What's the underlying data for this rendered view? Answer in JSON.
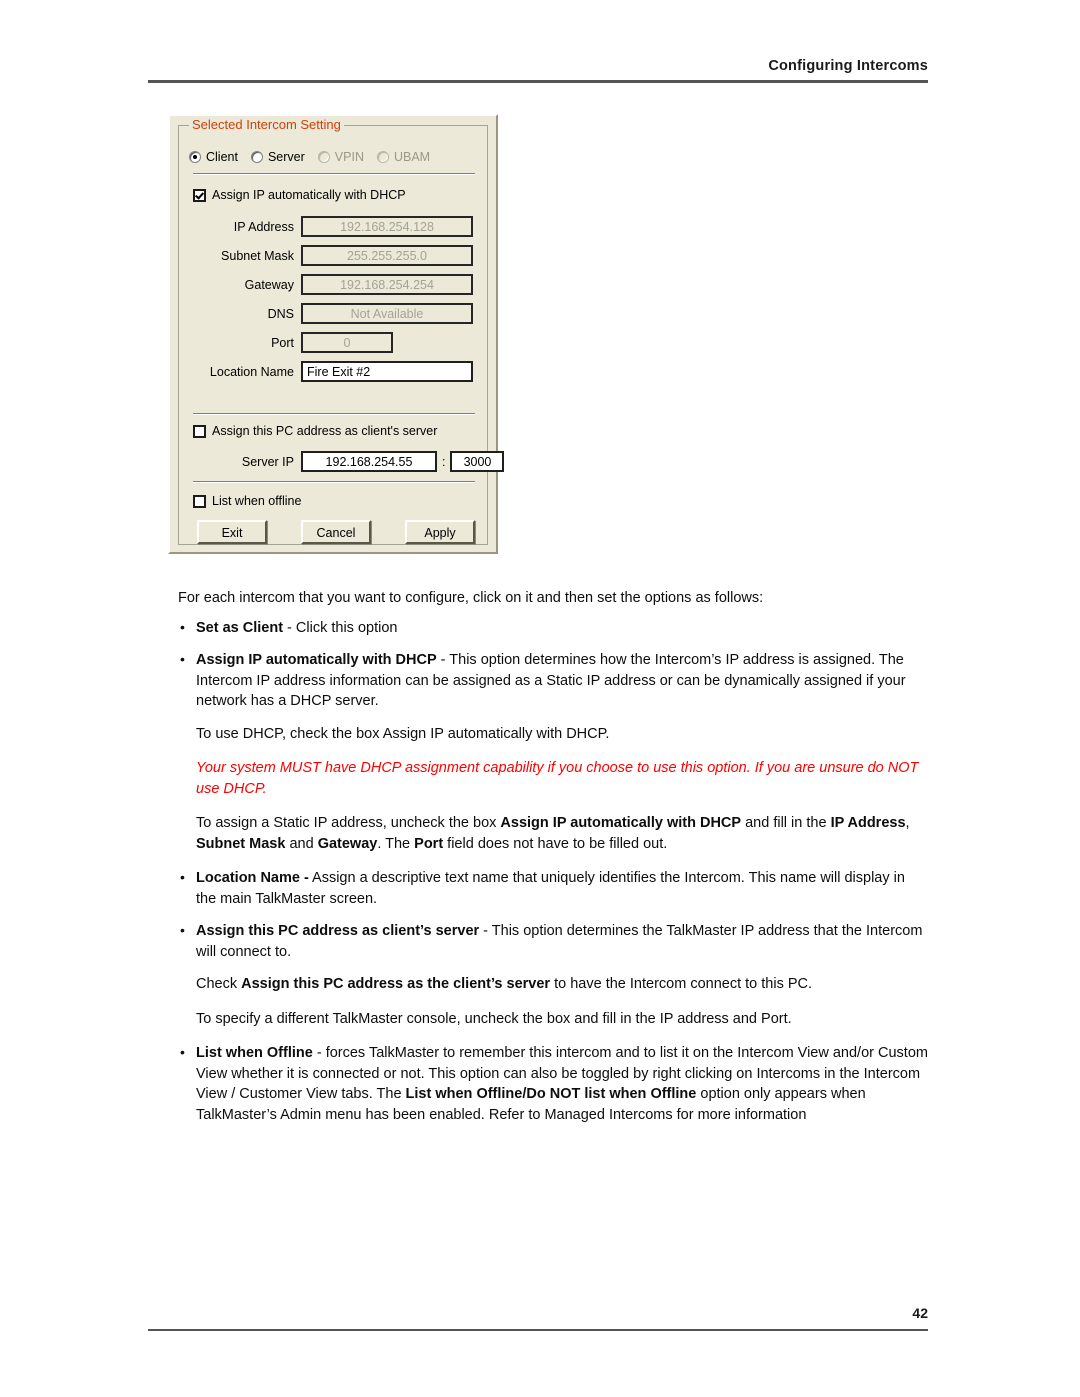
{
  "header": {
    "title": "Configuring Intercoms"
  },
  "footer": {
    "page_number": "42"
  },
  "dialog": {
    "legend": "Selected Intercom Setting",
    "radios": [
      {
        "label": "Client",
        "checked": true,
        "disabled": false
      },
      {
        "label": "Server",
        "checked": false,
        "disabled": false
      },
      {
        "label": "VPIN",
        "checked": false,
        "disabled": true
      },
      {
        "label": "UBAM",
        "checked": false,
        "disabled": true
      }
    ],
    "dhcp_checkbox": {
      "label": "Assign IP automatically with  DHCP",
      "checked": true
    },
    "fields": {
      "ip_address": {
        "label": "IP Address",
        "value": "192.168.254.128",
        "disabled": true
      },
      "subnet_mask": {
        "label": "Subnet Mask",
        "value": "255.255.255.0",
        "disabled": true
      },
      "gateway": {
        "label": "Gateway",
        "value": "192.168.254.254",
        "disabled": true
      },
      "dns": {
        "label": "DNS",
        "value": "Not Available",
        "disabled": true
      },
      "port": {
        "label": "Port",
        "value": "0",
        "disabled": true
      },
      "location_name": {
        "label": "Location Name",
        "value": "Fire Exit #2",
        "disabled": false
      }
    },
    "server_checkbox": {
      "label": "Assign this PC address as client's server",
      "checked": false
    },
    "server_ip": {
      "label": "Server IP",
      "address": "192.168.254.55",
      "separator": ":",
      "port": "3000"
    },
    "offline_checkbox": {
      "label": "List when offline",
      "checked": false
    },
    "buttons": {
      "exit": "Exit",
      "cancel": "Cancel",
      "apply": "Apply"
    },
    "colors": {
      "face": "#ECE9D8",
      "legend": "#D2400A",
      "disabled_text": "#A6A294"
    }
  },
  "body": {
    "intro": "For each intercom that you want to configure, click on it and then set the options as follows:",
    "bullet_client_bold": "Set as Client",
    "bullet_client_rest": " - Click this option",
    "bullet_dhcp_bold": "Assign IP automatically with DHCP",
    "bullet_dhcp_rest": " - This option determines how the Intercom’s IP address is assigned.  The Intercom IP address information can be assigned as a Static IP address or can be dynamically assigned if your network has a DHCP server.",
    "dhcp_check_line": "To use DHCP, check the box Assign IP automatically with DHCP.",
    "warning": "Your system MUST have DHCP assignment capability if you choose to use this option. If you are unsure do NOT use DHCP.",
    "static_line_1": "To assign a Static IP address, uncheck the box ",
    "static_bold_1": "Assign IP automatically with DHCP",
    "static_line_2": " and fill in the ",
    "static_bold_2": "IP Address",
    "static_line_3": ", ",
    "static_bold_3": "Subnet Mask",
    "static_line_4": " and ",
    "static_bold_4": "Gateway",
    "static_line_5": ".  The ",
    "static_bold_5": "Port",
    "static_line_6": " field does not have to be filled out.",
    "bullet_location_bold": "Location Name -",
    "bullet_location_rest": " Assign a descriptive text name that uniquely identifies the Intercom.  This name will display in the main TalkMaster screen.",
    "bullet_pcaddr_bold": "Assign this PC address as client’s server",
    "bullet_pcaddr_rest": " - This option determines the TalkMaster IP address that the Intercom will connect to.",
    "check_line_1": "Check ",
    "check_bold": "Assign this PC address as the client’s server",
    "check_line_2": " to have the Intercom connect to this PC.",
    "different_console": "To specify a different TalkMaster console, uncheck the box and fill in the IP address and Port.",
    "bullet_offline_bold": "List when Offline",
    "bullet_offline_rest_1": " - forces TalkMaster to remember this intercom and to list it on the Intercom View and/or Custom View whether it is connected or not.  This option can also be toggled by right clicking on Intercoms in the Intercom View / Customer View tabs. The ",
    "bullet_offline_bold_2": "List when Offline/Do NOT list when Offline",
    "bullet_offline_rest_2": " option only appears when TalkMaster’s Admin menu has been enabled.  Refer to Managed Intercoms for more information"
  }
}
